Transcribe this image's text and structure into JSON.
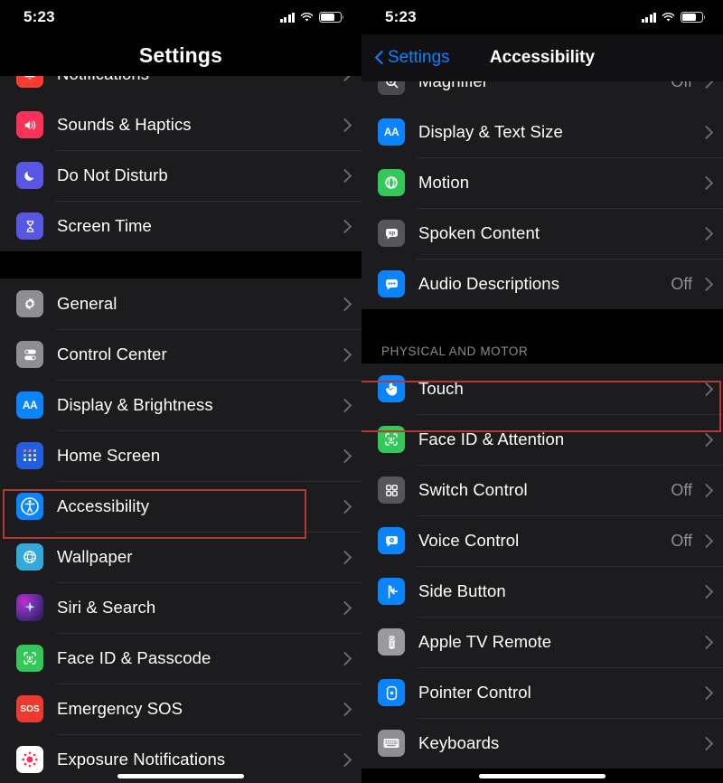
{
  "left": {
    "status": {
      "time": "5:23",
      "signal_icon": "cellular-bars-icon",
      "wifi_icon": "wifi-icon",
      "battery_icon": "battery-icon"
    },
    "nav": {
      "title": "Settings"
    },
    "clipped_row": {
      "label": "Notifications",
      "icon": "notifications-icon",
      "color": "#ff3b30"
    },
    "groups": [
      {
        "rows": [
          {
            "label": "Sounds & Haptics",
            "icon": "speaker-icon",
            "color": "#fc3158"
          },
          {
            "label": "Do Not Disturb",
            "icon": "moon-icon",
            "color": "#5856e4"
          },
          {
            "label": "Screen Time",
            "icon": "hourglass-icon",
            "color": "#5856e4"
          }
        ]
      },
      {
        "rows": [
          {
            "label": "General",
            "icon": "gear-icon",
            "color": "#8e8e93"
          },
          {
            "label": "Control Center",
            "icon": "toggles-icon",
            "color": "#8e8e93"
          },
          {
            "label": "Display & Brightness",
            "icon": "text-size-icon",
            "color": "#0a84ff"
          },
          {
            "label": "Home Screen",
            "icon": "home-screen-grid-icon",
            "color": "#1f5fe0"
          },
          {
            "label": "Accessibility",
            "icon": "accessibility-icon",
            "color": "#0a84ff",
            "highlighted": true
          },
          {
            "label": "Wallpaper",
            "icon": "wallpaper-flower-icon",
            "color": "#34aadc"
          },
          {
            "label": "Siri & Search",
            "icon": "siri-icon",
            "color": "#6a2ea0"
          },
          {
            "label": "Face ID & Passcode",
            "icon": "face-id-icon",
            "color": "#34c759"
          },
          {
            "label": "Emergency SOS",
            "icon": "sos-icon",
            "color": "#ef3b2f"
          },
          {
            "label": "Exposure Notifications",
            "icon": "exposure-notifications-icon",
            "color": "#ffffff"
          }
        ]
      }
    ]
  },
  "right": {
    "status": {
      "time": "5:23",
      "signal_icon": "cellular-bars-icon",
      "wifi_icon": "wifi-icon",
      "battery_icon": "battery-icon"
    },
    "nav": {
      "back_label": "Settings",
      "back_icon": "chevron-left-icon",
      "title": "Accessibility"
    },
    "clipped_row": {
      "label": "Magnifier",
      "icon": "magnifier-icon",
      "color": "#4a4a4e",
      "value": "Off"
    },
    "groups": [
      {
        "rows": [
          {
            "label": "Display & Text Size",
            "icon": "text-size-icon",
            "color": "#0a84ff"
          },
          {
            "label": "Motion",
            "icon": "motion-icon",
            "color": "#34c759"
          },
          {
            "label": "Spoken Content",
            "icon": "spoken-content-icon",
            "color": "#55555a"
          },
          {
            "label": "Audio Descriptions",
            "icon": "audio-descriptions-icon",
            "color": "#0a84ff",
            "value": "Off"
          }
        ]
      },
      {
        "header": "PHYSICAL AND MOTOR",
        "rows": [
          {
            "label": "Touch",
            "icon": "touch-hand-icon",
            "color": "#0a84ff",
            "highlighted": true
          },
          {
            "label": "Face ID & Attention",
            "icon": "face-id-icon",
            "color": "#34c759"
          },
          {
            "label": "Switch Control",
            "icon": "switch-control-icon",
            "color": "#55555a",
            "value": "Off"
          },
          {
            "label": "Voice Control",
            "icon": "voice-control-icon",
            "color": "#0a84ff",
            "value": "Off"
          },
          {
            "label": "Side Button",
            "icon": "side-button-icon",
            "color": "#0a84ff"
          },
          {
            "label": "Apple TV Remote",
            "icon": "apple-tv-remote-icon",
            "color": "#9a9a9e"
          },
          {
            "label": "Pointer Control",
            "icon": "pointer-control-icon",
            "color": "#0a84ff"
          },
          {
            "label": "Keyboards",
            "icon": "keyboard-icon",
            "color": "#8e8e93"
          }
        ]
      }
    ]
  },
  "highlight_color": "#b23a33"
}
